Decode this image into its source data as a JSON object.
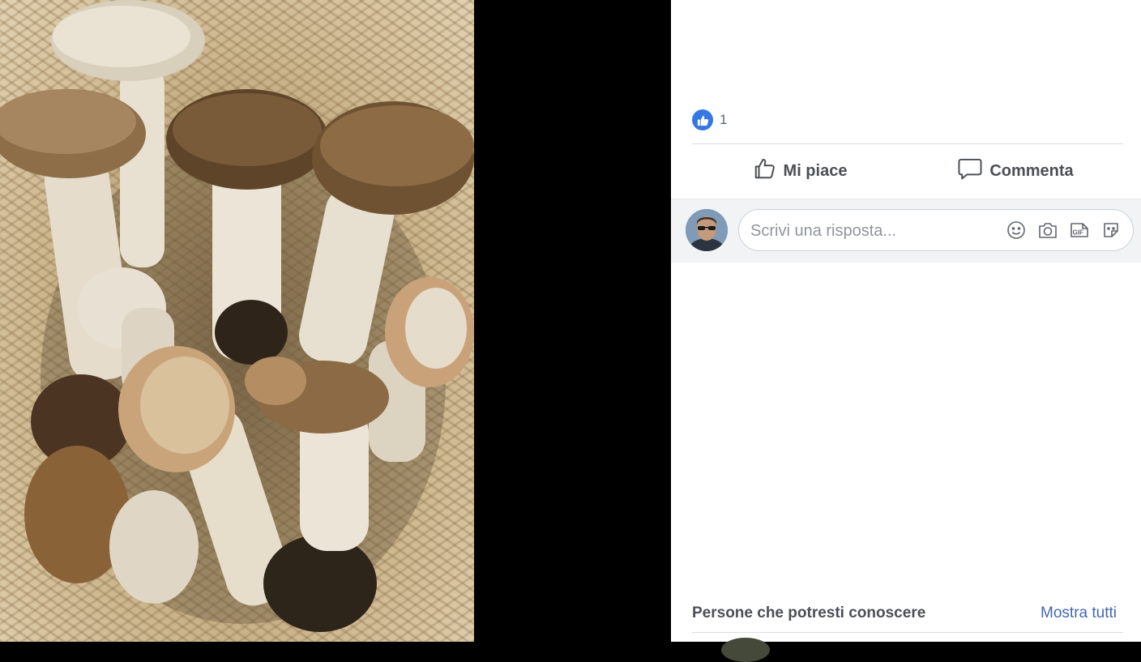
{
  "post": {
    "reaction_icon": "like-icon",
    "reaction_color": "#3578e5",
    "reaction_count": "1",
    "actions": {
      "like_label": "Mi piace",
      "comment_label": "Commenta"
    }
  },
  "composer": {
    "placeholder": "Scrivi una risposta...",
    "icons": [
      "emoji-icon",
      "camera-icon",
      "gif-icon",
      "sticker-icon"
    ]
  },
  "people_you_may_know": {
    "title": "Persone che potresti conoscere",
    "show_all_label": "Mostra tutti"
  },
  "colors": {
    "link": "#4267b2",
    "panel_bg": "#ffffff",
    "composer_bg": "#f2f3f5",
    "viewer_bg": "#000000"
  }
}
